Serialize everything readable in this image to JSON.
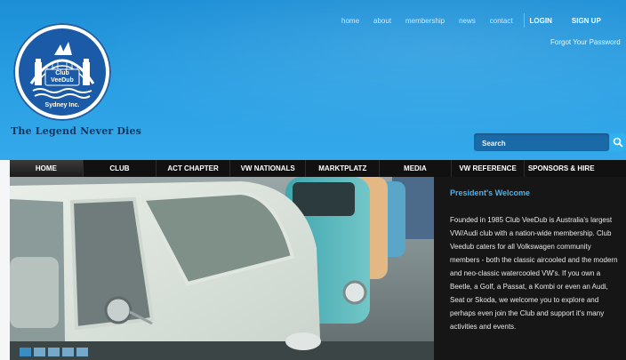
{
  "header": {
    "logo_text_top": "Club",
    "logo_text_mid": "VeeDub",
    "logo_text_bottom": "Sydney Inc.",
    "tagline": "The Legend Never Dies"
  },
  "topnav": {
    "links": [
      "home",
      "about",
      "membership",
      "news",
      "contact"
    ],
    "login": "LOGIN",
    "signup": "SIGN UP",
    "forgot": "Forgot Your Password"
  },
  "search": {
    "placeholder": "Search"
  },
  "mainnav": {
    "items": [
      "HOME",
      "CLUB",
      "ACT CHAPTER",
      "VW NATIONALS",
      "MARKTPLATZ",
      "MEDIA",
      "VW REFERENCE",
      "SPONSORS & HIRE"
    ],
    "active_index": 0
  },
  "welcome": {
    "title": "President's Welcome",
    "body": "Founded in 1985 Club VeeDub is Australia's largest VW/Audi club with a nation-wide membership. Club Veedub caters for all Volkswagen community members - both the classic aircooled and the modern and neo-classic watercooled VW's. If you own a Beetle, a Golf, a Passat, a Kombi or even an Audi, Seat or Skoda, we welcome you to explore and perhaps even join the Club and support it's many activities and events."
  },
  "slider": {
    "slides": 5,
    "active_index": 0
  },
  "colors": {
    "header_blue": "#2aa0e4",
    "nav_black": "#111111",
    "accent_blue": "#49b2f0",
    "logo_blue": "#1a5aa6"
  }
}
